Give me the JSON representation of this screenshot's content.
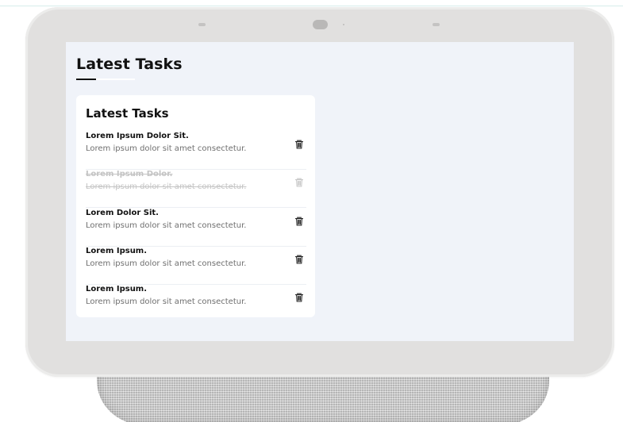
{
  "page": {
    "title": "Latest Tasks"
  },
  "card": {
    "title": "Latest Tasks"
  },
  "tasks": [
    {
      "title": "Lorem Ipsum Dolor Sit.",
      "description": "Lorem ipsum dolor sit amet consectetur.",
      "completed": false,
      "action_icon": "trash-icon"
    },
    {
      "title": "Lorem Ipsum Dolor.",
      "description": "Lorem ipsum dolor sit amet consectetur.",
      "completed": true,
      "action_icon": "trash-icon"
    },
    {
      "title": "Lorem Dolor Sit.",
      "description": "Lorem ipsum dolor sit amet consectetur.",
      "completed": false,
      "action_icon": "trash-icon"
    },
    {
      "title": "Lorem Ipsum.",
      "description": "Lorem ipsum dolor sit amet consectetur.",
      "completed": false,
      "action_icon": "trash-icon"
    },
    {
      "title": "Lorem Ipsum.",
      "description": "Lorem ipsum dolor sit amet consectetur.",
      "completed": false,
      "action_icon": "trash-icon"
    }
  ],
  "colors": {
    "screen_background": "#f0f3f9",
    "card_background": "#ffffff",
    "bezel": "#e1e0df",
    "completed_text": "#c4c4c4"
  }
}
